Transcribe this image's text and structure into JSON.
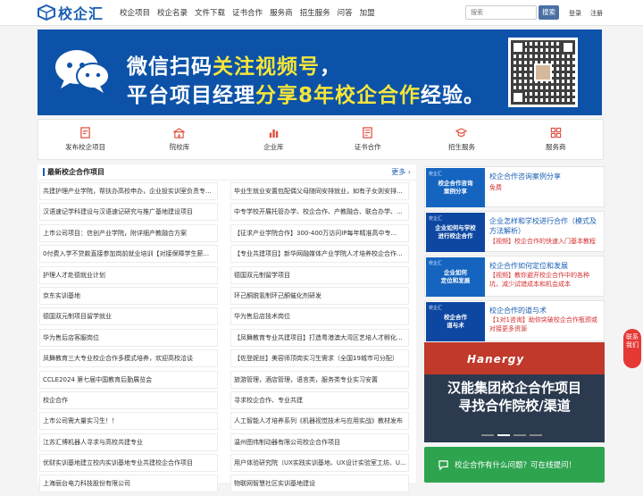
{
  "header": {
    "logo_text": "校企汇",
    "nav": [
      "校企项目",
      "校企名录",
      "文件下载",
      "证书合作",
      "服务商",
      "招生服务",
      "问答",
      "加盟"
    ],
    "search_placeholder": "搜索",
    "search_button": "搜索",
    "login": "登录",
    "register": "注册"
  },
  "banner": {
    "line1_a": "微信扫码",
    "line1_b": "关注视频号",
    "line1_c": "，",
    "line2_a": "平台项目经理",
    "line2_b": "分享8年",
    "line2_c": "校企合作",
    "line2_d": "经验。"
  },
  "quick_links": [
    "发布校企项目",
    "院校库",
    "企业库",
    "证书合作",
    "招生服务",
    "服务商"
  ],
  "news": {
    "title": "最新校企合作项目",
    "more": "更多",
    "left": [
      "共建护理产业学院，帮扶办高校申办，企业投实训室负责专...",
      "汉语速记学科建设与汉语速记研究与推广基地建设项目",
      "上市公司项目：信创产业学院，附详细产教融合方案",
      "0付费入学不贷款直接参加岗前就业培训【对接保障学生薪...",
      "护理人才赴德就业计划",
      "京东实训基地",
      "德国双元制项目留学就业",
      "华为售后店客服岗位",
      "凤舞教育三大专业校企合作多模式培养，欢迎高校洽谈",
      "CCLE2024 第七届中国教育后勤展览会",
      "校企合作",
      "上市公司需大量实习生！！",
      "江苏汇博机器人寻求与高校共建专业",
      "优财实训基地建立校内实训基地专业共建校企合作项目",
      "上海丽台电力科技股份有限公司"
    ],
    "right": [
      "毕业生就业安置包配偶父母随同安排就业，如有子女则安排...",
      "中专学校开展托管办学、校企合作、产教融合、联合办学、...",
      "【征求产业学院合作】300-400万访问IP每年精准高中专...",
      "【专业共建项目】新华网融媒体产业学院人才培养校企合作...",
      "德国双元制留学项目",
      "环己酮脱氢制环己酮催化剂研发",
      "华为售后店技术岗位",
      "【凤舞教育专业共建项目】打造粤港澳大湾区艺培人才孵化...",
      "【佐登妮丝】美容师顶岗实习生需求（全国19城市可分配）",
      "旅游管理，酒店管理，语言类，服务类专业实习安置",
      "寻求校企合作、专业共建",
      "人工智能人才培养系列《机器视觉技术与应用实战》教材发布",
      "温州图伟制动器有限公司校企合作项目",
      "用户体验研究院（UX实践实训基地、UX设计实验室工坊、U...",
      "物联网智慧社区实训基地建设"
    ]
  },
  "cases": [
    {
      "thumb_tag": "校企汇",
      "thumb": "校企合作咨询\n案例分享",
      "title": "校企合作咨询案例分享",
      "sub": "免费"
    },
    {
      "thumb_tag": "校企汇",
      "thumb": "企业如何与学校\n进行校企合作",
      "title": "企业怎样和学校进行合作（模式及方法解析）",
      "sub": "【视频】校企合作的快速入门基本教程"
    },
    {
      "thumb_tag": "校企汇",
      "thumb": "企业如何\n定位和发展",
      "title": "校企合作如何定位和发展",
      "sub": "【视频】教你避开校企合作中的各种坑，减少试错成本和机会成本"
    },
    {
      "thumb_tag": "校企汇",
      "thumb": "校企合作\n道与术",
      "title": "校企合作的道与术",
      "sub": "【1对1咨询】助你突破校企合作瓶颈或对接更多资源"
    }
  ],
  "ad": {
    "brand": "Hanergy",
    "line1": "汉能集团校企合作项目",
    "line2": "寻找合作院校/渠道"
  },
  "ask": {
    "text": "校企合作有什么问题？可在线提问！"
  },
  "float_contact": "联系我们",
  "colors": {
    "brand": "#1a5fb4",
    "highlight": "#f5e53a",
    "ask_green": "#2ea44f",
    "float_red": "#e53935"
  }
}
